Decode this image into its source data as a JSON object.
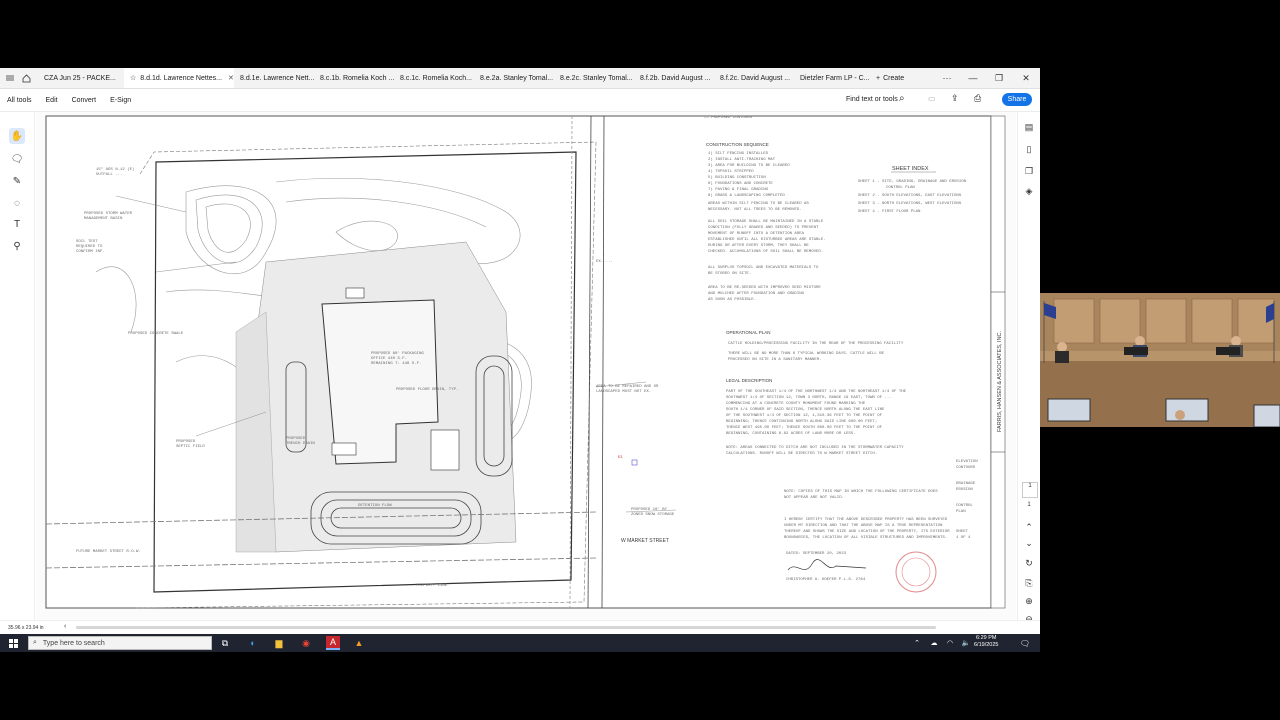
{
  "tabs": [
    {
      "label": "CZA Jun 25 - PACKE...",
      "active": false
    },
    {
      "label": "8.d.1d. Lawrence Nettes...",
      "active": true
    },
    {
      "label": "8.d.1e. Lawrence Nett...",
      "active": false
    },
    {
      "label": "8.c.1b. Romelia Koch ...",
      "active": false
    },
    {
      "label": "8.c.1c. Romelia Koch...",
      "active": false
    },
    {
      "label": "8.e.2a. Stanley Tomal...",
      "active": false
    },
    {
      "label": "8.e.2c. Stanley Tomal...",
      "active": false
    },
    {
      "label": "8.f.2b. David August ...",
      "active": false
    },
    {
      "label": "8.f.2c. David August ...",
      "active": false
    },
    {
      "label": "Dietzler Farm LP - C...",
      "active": false
    }
  ],
  "create_label": "Create",
  "menu": {
    "all_tools": "All tools",
    "edit": "Edit",
    "convert": "Convert",
    "esign": "E-Sign"
  },
  "find_label": "Find text or tools",
  "share_label": "Share",
  "status_size": "35.96 x 23.94 in",
  "taskbar": {
    "search_placeholder": "Type here to search",
    "time": "6:29 PM",
    "date": "6/19/2025"
  },
  "sheet": {
    "sheet_index_title": "SHEET INDEX",
    "street_label": "W MARKET STREET",
    "firm_label": "FARRIS, HANSEN & ASSOCIATES, INC.",
    "construction_sequence": "CONSTRUCTION SEQUENCE",
    "operational_plan": "OPERATIONAL PLAN",
    "legal_description": "LEGAL DESCRIPTION",
    "date_label": "DATED: SEPTEMBER 20, 2023",
    "future_market": "FUTURE MARKET STREET R.O.W.",
    "proposed_floor_drain": "PROPOSED FLOOR DRAIN, TYP."
  },
  "colors": {
    "accent": "#1473e6",
    "taskbar": "#1f2430"
  }
}
